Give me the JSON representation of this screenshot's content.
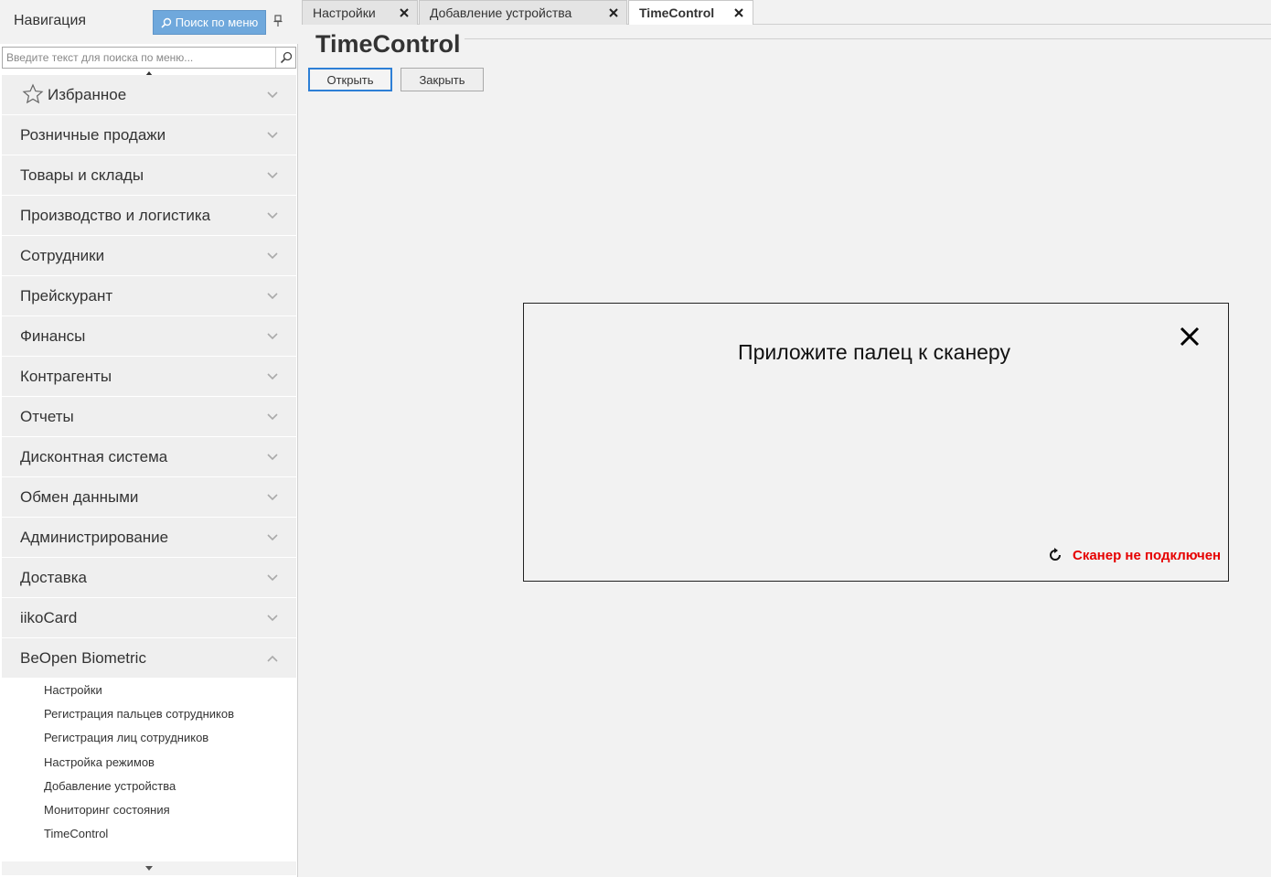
{
  "navigation": {
    "title": "Навигация",
    "menu_search_label": "Поиск по меню",
    "search_placeholder": "Введите текст для поиска по меню...",
    "favorites_label": "Избранное",
    "items": [
      "Розничные продажи",
      "Товары и склады",
      "Производство и логистика",
      "Сотрудники",
      "Прейскурант",
      "Финансы",
      "Контрагенты",
      "Отчеты",
      "Дисконтная система",
      "Обмен данными",
      "Администрирование",
      "Доставка",
      "iikoCard"
    ],
    "expanded_item": "BeOpen Biometric",
    "sub_items": [
      "Настройки",
      "Регистрация пальцев сотрудников",
      "Регистрация лиц сотрудников",
      "Настройка режимов",
      "Добавление устройства",
      "Мониторинг состояния",
      "TimeControl"
    ]
  },
  "tabs": [
    {
      "label": "Настройки",
      "active": false
    },
    {
      "label": "Добавление устройства",
      "active": false
    },
    {
      "label": "TimeControl",
      "active": true
    }
  ],
  "main": {
    "title": "TimeControl",
    "open_button": "Открыть",
    "close_button": "Закрыть"
  },
  "scanner": {
    "message": "Приложите палец к сканеру",
    "status": "Сканер не подключен",
    "status_color": "#e60000"
  },
  "colors": {
    "accent": "#6fa8dc",
    "focus_border": "#2d7fd6"
  }
}
